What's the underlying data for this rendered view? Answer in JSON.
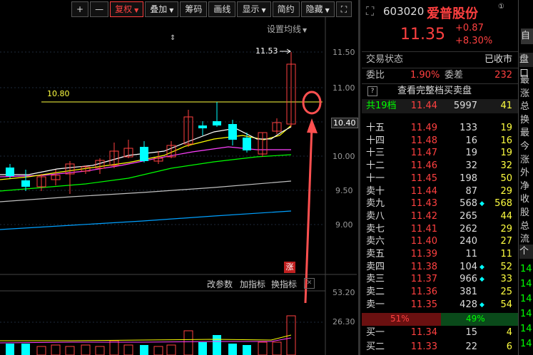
{
  "toolbar": {
    "plus": "+",
    "minus": "—",
    "fuquan": "复权",
    "diejia": "叠加",
    "chouma": "筹码",
    "huaxian": "画线",
    "xianshi": "显示",
    "jianyue": "简约",
    "yincang": "隐藏",
    "expand": "⛶"
  },
  "chart": {
    "set_ma": "设置均线",
    "max_label": "11.53",
    "line_label": "10.80",
    "price_axis": [
      "11.50",
      "11.00",
      "10.40",
      "10.00",
      "9.50",
      "9.00"
    ],
    "current_price_tag": "10.40",
    "zhang": "涨",
    "indicator_btns": [
      "改参数",
      "加指标",
      "换指标"
    ],
    "vol_axis": [
      "53.20",
      "26.30"
    ],
    "colors": {
      "up": "#ff4040",
      "down": "#00ffff",
      "ma5": "#ffffff",
      "ma10": "#ffff00",
      "ma20": "#ff40ff",
      "ma30": "#00ff00",
      "ma60": "#c0c0c0",
      "ma120": "#00a0ff",
      "annot": "#ff5050"
    }
  },
  "quote": {
    "code": "603020",
    "name": "爱普股份",
    "info_icon": "①",
    "price": "11.35",
    "change": "+0.87",
    "change_pct": "+8.30%",
    "status_label": "交易状态",
    "status_value": "已收市",
    "weibi_label": "委比",
    "weibi_value": "1.90%",
    "weicha_label": "委差",
    "weicha_value": "232",
    "full_book_btn": "查看完整档买卖盘",
    "summary": {
      "name": "共19档",
      "price": "11.44",
      "vol": "5997",
      "chg": "41"
    },
    "asks": [
      {
        "name": "十五",
        "price": "11.49",
        "vol": "133",
        "dot": "◆",
        "chg": "19"
      },
      {
        "name": "十四",
        "price": "11.48",
        "vol": "16",
        "dot": "◆",
        "chg": "16"
      },
      {
        "name": "十三",
        "price": "11.47",
        "vol": "19",
        "dot": "◆",
        "chg": "19"
      },
      {
        "name": "十二",
        "price": "11.46",
        "vol": "32",
        "dot": "◆",
        "chg": "32"
      },
      {
        "name": "十一",
        "price": "11.45",
        "vol": "198",
        "dot": "◆",
        "chg": "50"
      },
      {
        "name": "卖十",
        "price": "11.44",
        "vol": "87",
        "dot": "◆",
        "chg": "29"
      },
      {
        "name": "卖九",
        "price": "11.43",
        "vol": "568",
        "dot": "◆",
        "chg": "568"
      },
      {
        "name": "卖八",
        "price": "11.42",
        "vol": "265",
        "dot": "◆",
        "chg": "44"
      },
      {
        "name": "卖七",
        "price": "11.41",
        "vol": "262",
        "dot": "◆",
        "chg": "29"
      },
      {
        "name": "卖六",
        "price": "11.40",
        "vol": "240",
        "dot": "◆",
        "chg": "27"
      },
      {
        "name": "卖五",
        "price": "11.39",
        "vol": "11",
        "dot": "◆",
        "chg": "11"
      },
      {
        "name": "卖四",
        "price": "11.38",
        "vol": "104",
        "dot": "◆",
        "chg": "52"
      },
      {
        "name": "卖三",
        "price": "11.37",
        "vol": "966",
        "dot": "◆",
        "chg": "33"
      },
      {
        "name": "卖二",
        "price": "11.36",
        "vol": "381",
        "dot": "◆",
        "chg": "25"
      },
      {
        "name": "卖一",
        "price": "11.35",
        "vol": "428",
        "dot": "◆",
        "chg": "54"
      }
    ],
    "ratio": {
      "left": "51%",
      "right": "49%"
    },
    "bids": [
      {
        "name": "买一",
        "price": "11.34",
        "vol": "15",
        "dot": "◆",
        "chg": "4"
      },
      {
        "name": "买二",
        "price": "11.33",
        "vol": "22",
        "dot": "◆",
        "chg": "6"
      }
    ]
  },
  "side": {
    "top_btn": "自",
    "tab": "盘口",
    "items": [
      "最",
      "涨",
      "总",
      "换",
      "最",
      "今",
      "涨",
      "外",
      "净",
      "收",
      "股",
      "总",
      "流"
    ],
    "bottom_tab": "个",
    "values": [
      "14",
      "14",
      "14",
      "14",
      "14",
      "14"
    ]
  }
}
